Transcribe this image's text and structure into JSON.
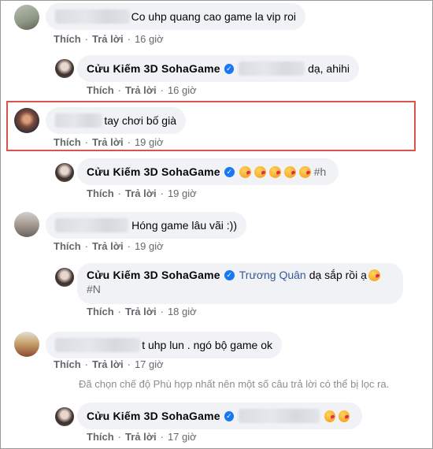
{
  "actions": {
    "like": "Thích",
    "reply": "Trả lời",
    "separator": "·"
  },
  "page_author": "Cửu Kiếm 3D SohaGame",
  "comments": [
    {
      "text": "Co uhp quang cao game la vip roi",
      "time": "16 giờ"
    },
    {
      "text": "dạ, ahihi",
      "time": "16 giờ"
    },
    {
      "text": "tay chơi bố già",
      "time": "19 giờ"
    },
    {
      "text": "#h",
      "time": "19 giờ",
      "emoji_count": 5
    },
    {
      "text": "Hóng game lâu vãi :))",
      "time": "19 giờ"
    },
    {
      "mention": "Trương Quân",
      "text": "dạ sắp rồi ạ",
      "tag": "#N",
      "time": "18 giờ"
    },
    {
      "text": "t uhp lun . ngó bộ game ok",
      "time": "17 giờ"
    },
    {
      "time": "17 giờ",
      "emoji_count": 2
    }
  ],
  "filter_notice": "Đã chọn chế độ Phù hợp nhất nên một số câu trả lời có thể bị lọc ra.",
  "colors": {
    "highlight_border": "#d9534f",
    "bubble": "#f0f2f5",
    "verified": "#1877f2",
    "mention": "#385898"
  }
}
